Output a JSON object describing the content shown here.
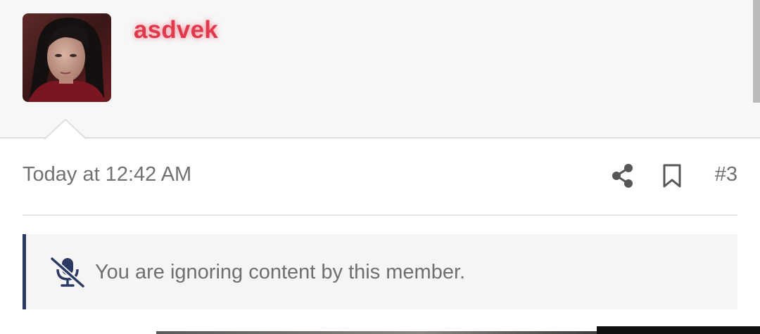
{
  "user": {
    "username": "asdvek",
    "avatar_icon": "avatar-photo"
  },
  "post": {
    "date": "Today at 12:42 AM",
    "number": "#3",
    "share_icon": "share-icon",
    "bookmark_icon": "bookmark-icon"
  },
  "notice": {
    "text": "You are ignoring content by this member.",
    "icon": "microphone-slash-icon"
  },
  "colors": {
    "username": "#e0394d",
    "notice_border": "#2b3a63",
    "header_bg": "#f7f7f7",
    "meta_text": "#717171"
  }
}
